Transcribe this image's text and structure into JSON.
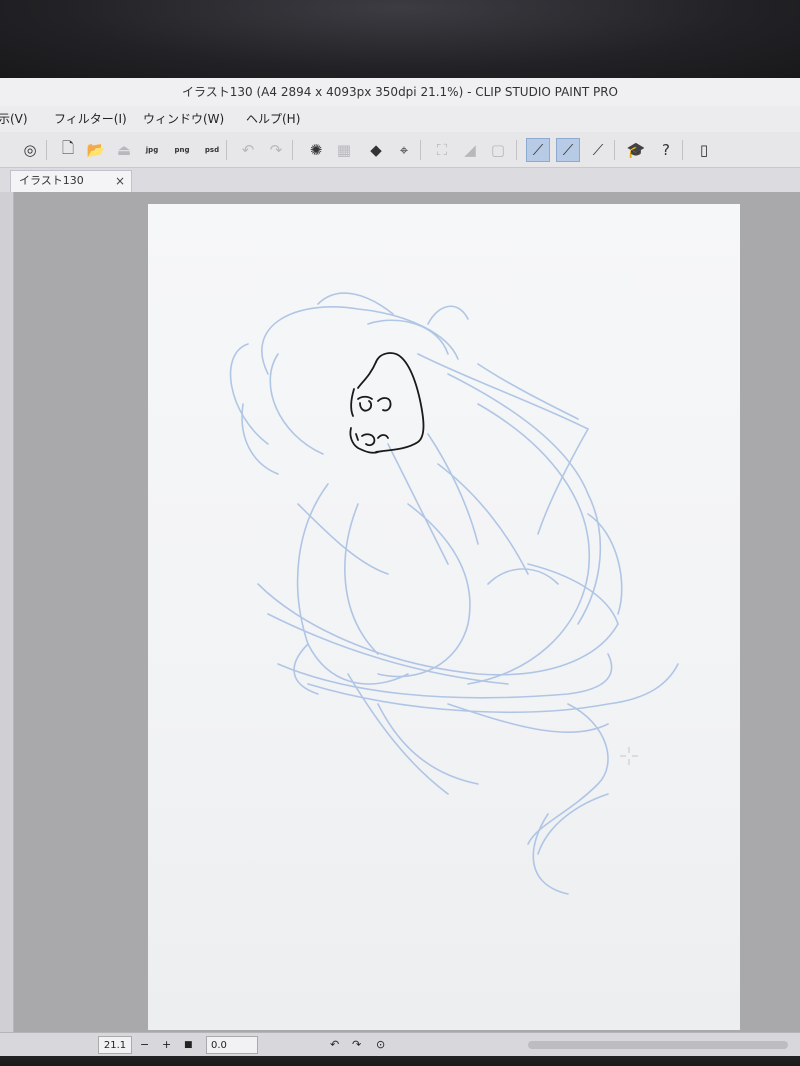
{
  "window": {
    "title": "イラスト130 (A4 2894 x 4093px 350dpi 21.1%)  - CLIP STUDIO PAINT PRO"
  },
  "menu": {
    "items": [
      {
        "label": "示(V)"
      },
      {
        "label": "フィルター(I)"
      },
      {
        "label": "ウィンドウ(W)"
      },
      {
        "label": "ヘルプ(H)"
      }
    ]
  },
  "toolbar": {
    "icons": [
      {
        "name": "clip-studio-logo-icon",
        "glyph": "◎",
        "state": "normal"
      },
      {
        "name": "new-file-icon",
        "glyph": "🗋",
        "state": "normal"
      },
      {
        "name": "open-folder-icon",
        "glyph": "📂",
        "state": "normal"
      },
      {
        "name": "save-disabled-icon",
        "glyph": "⏏",
        "state": "dim"
      },
      {
        "name": "export-jpg-icon",
        "glyph": "jpg",
        "state": "normal"
      },
      {
        "name": "export-png-icon",
        "glyph": "png",
        "state": "normal"
      },
      {
        "name": "export-psd-icon",
        "glyph": "psd",
        "state": "normal"
      },
      {
        "name": "undo-icon",
        "glyph": "↶",
        "state": "dim"
      },
      {
        "name": "redo-icon",
        "glyph": "↷",
        "state": "dim"
      },
      {
        "name": "loading-spinner-icon",
        "glyph": "✺",
        "state": "normal"
      },
      {
        "name": "clear-layer-icon",
        "glyph": "▦",
        "state": "dim"
      },
      {
        "name": "fill-icon",
        "glyph": "◆",
        "state": "normal"
      },
      {
        "name": "transform-icon",
        "glyph": "⌖",
        "state": "normal"
      },
      {
        "name": "deselect-icon",
        "glyph": "⛶",
        "state": "dim"
      },
      {
        "name": "invert-selection-icon",
        "glyph": "◢",
        "state": "dim"
      },
      {
        "name": "selection-border-icon",
        "glyph": "▢",
        "state": "dim"
      },
      {
        "name": "snap-to-ruler-icon",
        "glyph": "⟋",
        "state": "active"
      },
      {
        "name": "snap-to-special-ruler-icon",
        "glyph": "⟋",
        "state": "active"
      },
      {
        "name": "snap-to-grid-icon",
        "glyph": "⟋",
        "state": "normal"
      },
      {
        "name": "learn-icon",
        "glyph": "🎓",
        "state": "normal"
      },
      {
        "name": "help-icon",
        "glyph": "?",
        "state": "normal"
      },
      {
        "name": "smartphone-icon",
        "glyph": "▯",
        "state": "normal"
      }
    ]
  },
  "document": {
    "tab_label": "イラスト130",
    "close_glyph": "×"
  },
  "status": {
    "zoom": "21.1",
    "zoom_out": "−",
    "zoom_in": "+",
    "stop": "■",
    "angle": "0.0",
    "rotate_left": "↶",
    "rotate_right": "↷",
    "reset_rotation": "⊙"
  },
  "colors": {
    "sketch_blue": "#a9c1e4",
    "ink_black": "#1a1a1a",
    "selected_tool": "#b7cbe6"
  }
}
